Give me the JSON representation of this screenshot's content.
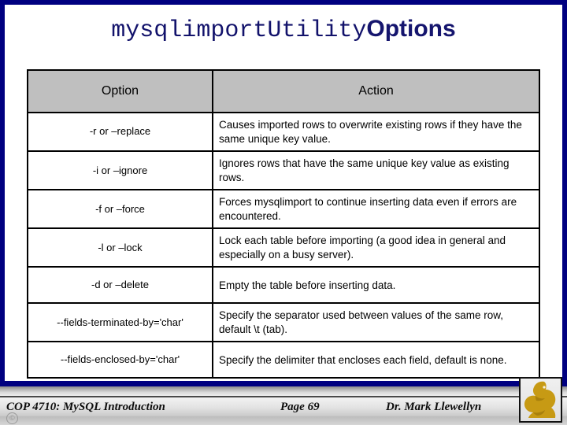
{
  "slide": {
    "title_mono": "mysqlimport",
    "title_mono_suffix": "Utility",
    "title_rest": "Options",
    "accent_color": "#000080",
    "title_color": "#15156e",
    "header_fill": "#bfbfbf"
  },
  "table": {
    "headers": [
      "Option",
      "Action"
    ],
    "rows": [
      {
        "option": "-r or –replace",
        "action": "Causes imported rows to overwrite existing rows if they have the same unique key value."
      },
      {
        "option": "-i or –ignore",
        "action": "Ignores rows that have the same unique key value as existing rows."
      },
      {
        "option": "-f or –force",
        "action": "Forces mysqlimport to continue inserting data even if errors are encountered."
      },
      {
        "option": "-l or –lock",
        "action": "Lock each table before importing (a good idea in general and especially on a busy server)."
      },
      {
        "option": "-d or –delete",
        "action": "Empty the table before inserting data."
      },
      {
        "option": "--fields-terminated-by='char'",
        "action": "Specify the separator used between values of the same row, default \\t (tab)."
      },
      {
        "option": "--fields-enclosed-by='char'",
        "action": "Specify the delimiter that encloses each field, default is none."
      }
    ]
  },
  "footer": {
    "course": "COP 4710: MySQL Introduction",
    "page": "Page 69",
    "author": "Dr. Mark Llewellyn",
    "corner_mark": "©",
    "logo_name": "ucf-pegasus-logo",
    "logo_color": "#c79a14"
  }
}
